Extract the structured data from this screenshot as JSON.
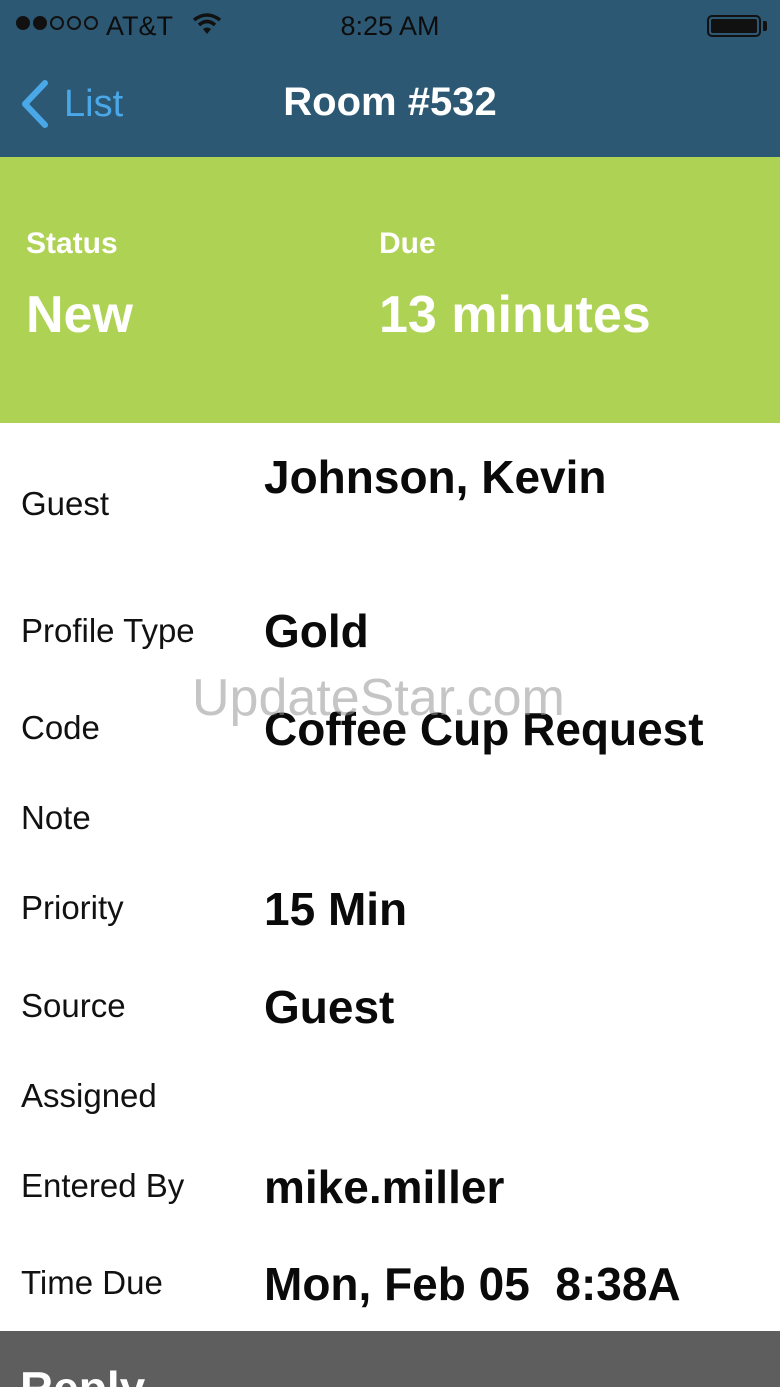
{
  "status_bar": {
    "carrier": "AT&T",
    "time": "8:25 AM"
  },
  "nav": {
    "back_label": "List",
    "title": "Room #532"
  },
  "banner": {
    "status_label": "Status",
    "status_value": "New",
    "due_label": "Due",
    "due_value": "13 minutes",
    "color": "#aed254"
  },
  "details": {
    "guest_label": "Guest",
    "guest_value": "Johnson, Kevin",
    "profile_label": "Profile Type",
    "profile_value": "Gold",
    "code_label": "Code",
    "code_value": "Coffee Cup Request",
    "note_label": "Note",
    "priority_label": "Priority",
    "priority_value": "15 Min",
    "source_label": "Source",
    "source_value": "Guest",
    "assigned_label": "Assigned",
    "entered_label": "Entered By",
    "entered_value": "mike.miller",
    "time_due_label": "Time Due",
    "time_due_value": "Mon, Feb 05  8:38A"
  },
  "watermark": "UpdateStar.com",
  "reply": {
    "label": "Reply"
  }
}
